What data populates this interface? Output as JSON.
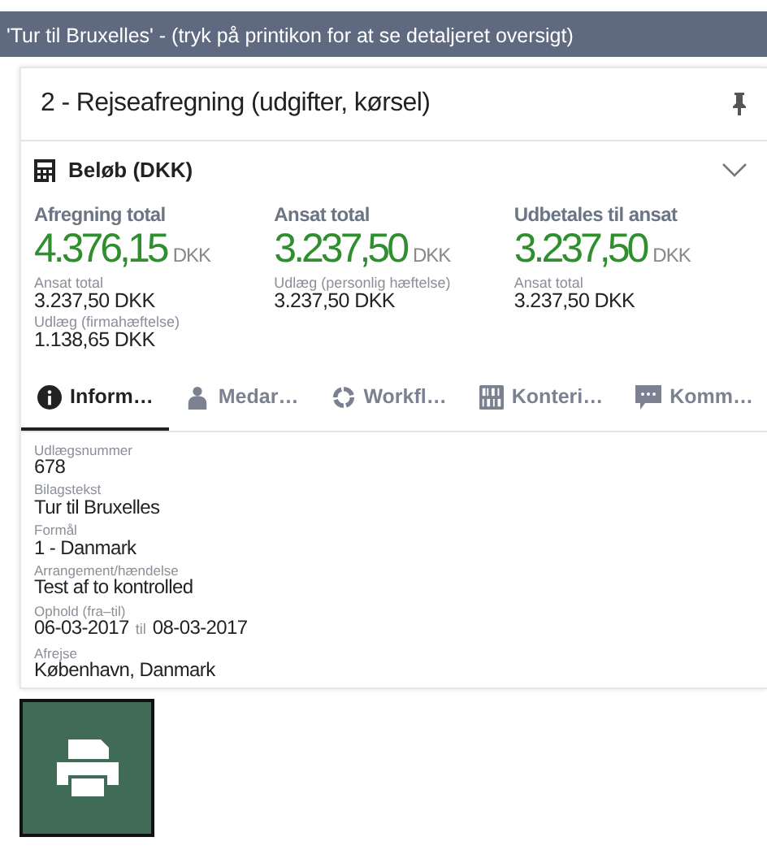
{
  "header": {
    "title": "'Tur til Bruxelles' - (tryk på printikon for at se detaljeret oversigt)"
  },
  "card": {
    "title": "2 - Rejseafregning (udgifter, kørsel)",
    "pinned": true
  },
  "amounts": {
    "title": "Beløb (DKK)",
    "expanded": true,
    "columns": [
      {
        "label": "Afregning total",
        "value": "4.376,15",
        "currency": "DKK",
        "details": [
          {
            "label": "Ansat total",
            "value": "3.237,50 DKK"
          },
          {
            "label": "Udlæg (firmahæftelse)",
            "value": "1.138,65 DKK"
          }
        ]
      },
      {
        "label": "Ansat total",
        "value": "3.237,50",
        "currency": "DKK",
        "details": [
          {
            "label": "Udlæg (personlig hæftelse)",
            "value": "3.237,50 DKK"
          }
        ]
      },
      {
        "label": "Udbetales til ansat",
        "value": "3.237,50",
        "currency": "DKK",
        "details": [
          {
            "label": "Ansat total",
            "value": "3.237,50 DKK"
          }
        ]
      }
    ]
  },
  "tabs": [
    {
      "label": "Inform…",
      "kind": "info",
      "selected": true
    },
    {
      "label": "Medar…",
      "kind": "person",
      "selected": false
    },
    {
      "label": "Workfl…",
      "kind": "workflow",
      "selected": false
    },
    {
      "label": "Konteri…",
      "kind": "binary",
      "selected": false
    },
    {
      "label": "Komm…",
      "kind": "comment",
      "selected": false
    }
  ],
  "fields": [
    {
      "label": "Udlægsnummer",
      "value": "678"
    },
    {
      "label": "Bilagstekst",
      "value": "Tur til Bruxelles"
    },
    {
      "label": "Formål",
      "value": "1 - Danmark"
    },
    {
      "label": "Arrangement/hændelse",
      "value": "Test af to kontrolled"
    },
    {
      "label": "Ophold (fra–til)",
      "kind": "range",
      "from": "06-03-2017",
      "sep": "til",
      "to": "08-03-2017"
    },
    {
      "label": "Afrejse",
      "value": "København, Danmark"
    }
  ],
  "print_button": {
    "kind": "print"
  }
}
